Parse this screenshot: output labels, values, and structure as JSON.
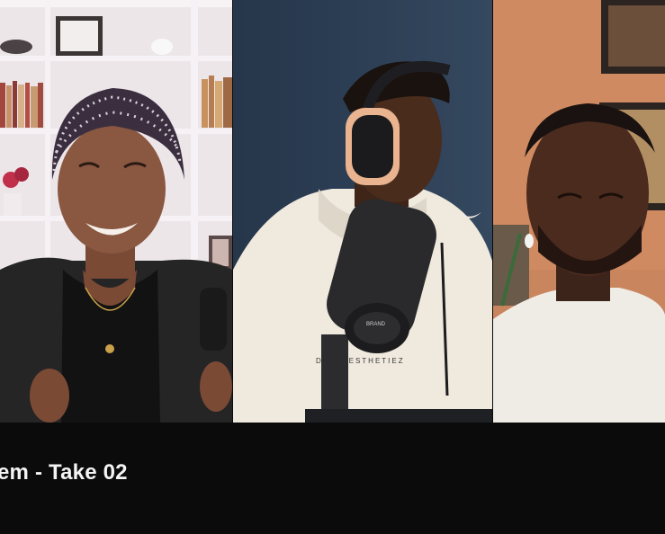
{
  "stream": {
    "title_visible": "em - Take 02"
  },
  "participants": [
    {
      "id": "left",
      "background": "#e9e3e6"
    },
    {
      "id": "middle",
      "background": "#2e3f55"
    },
    {
      "id": "right",
      "background": "#c9855e"
    }
  ],
  "hoodie_print": "DAIL  AESTHETIEZ",
  "mic_badge": "BRAND",
  "colors": {
    "canvas": "#0b0b0b",
    "caption_text": "#f4f4f4"
  }
}
